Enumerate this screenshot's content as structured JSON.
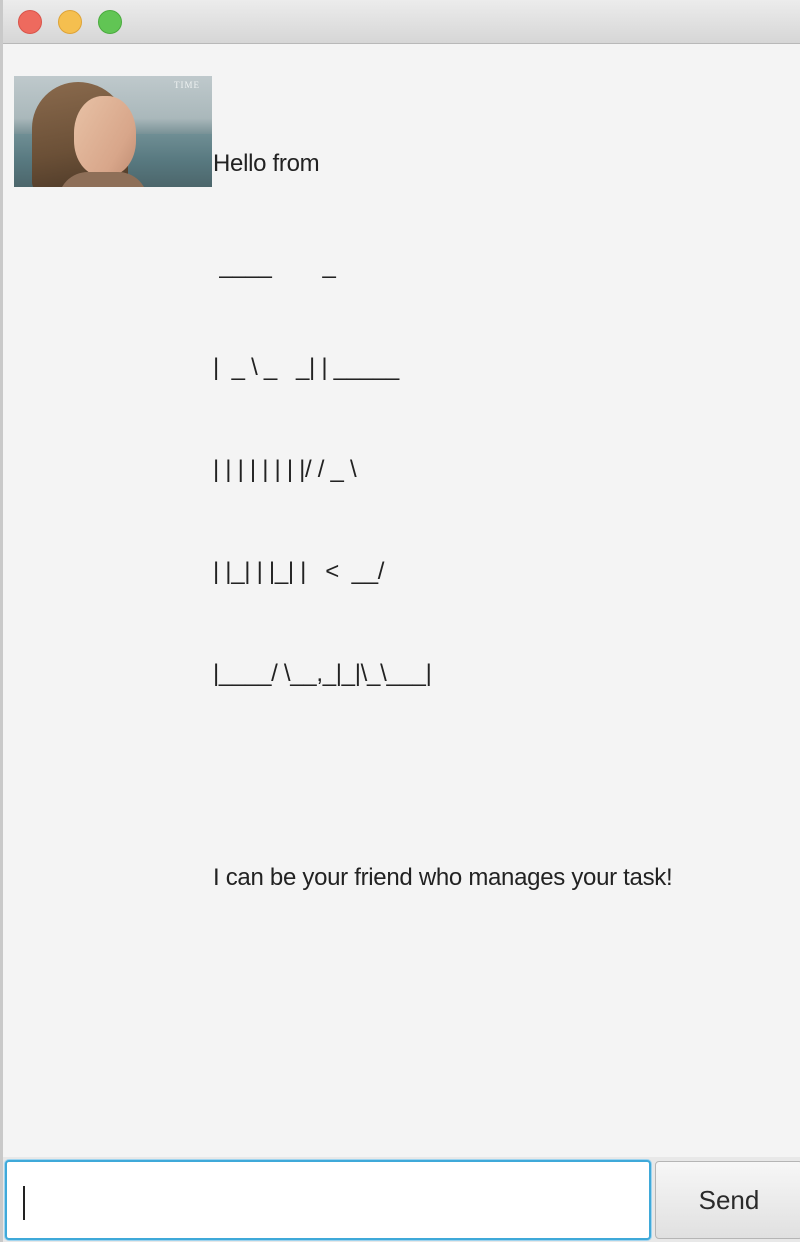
{
  "window": {
    "controls": [
      "close",
      "minimize",
      "zoom"
    ],
    "colors": {
      "close": "#ee6a5e",
      "minimize": "#f5bf4f",
      "zoom": "#61c554"
    }
  },
  "dialog": {
    "avatar": {
      "watermark": "TIME",
      "icon": "user-avatar-photo"
    },
    "greeting": "Hello from",
    "logo_lines": [
      " ____        _        ",
      "|  _ \\ _   _| | _____ ",
      "| | | | | | | |/ / _ \\",
      "| |_| | |_| |   <  __/",
      "|____/ \\__,_|_|\\_\\___|"
    ],
    "intro": "I can be your friend who manages your task!"
  },
  "input_bar": {
    "input_value": "",
    "send_label": "Send",
    "focus_color": "#3fa9d9"
  }
}
